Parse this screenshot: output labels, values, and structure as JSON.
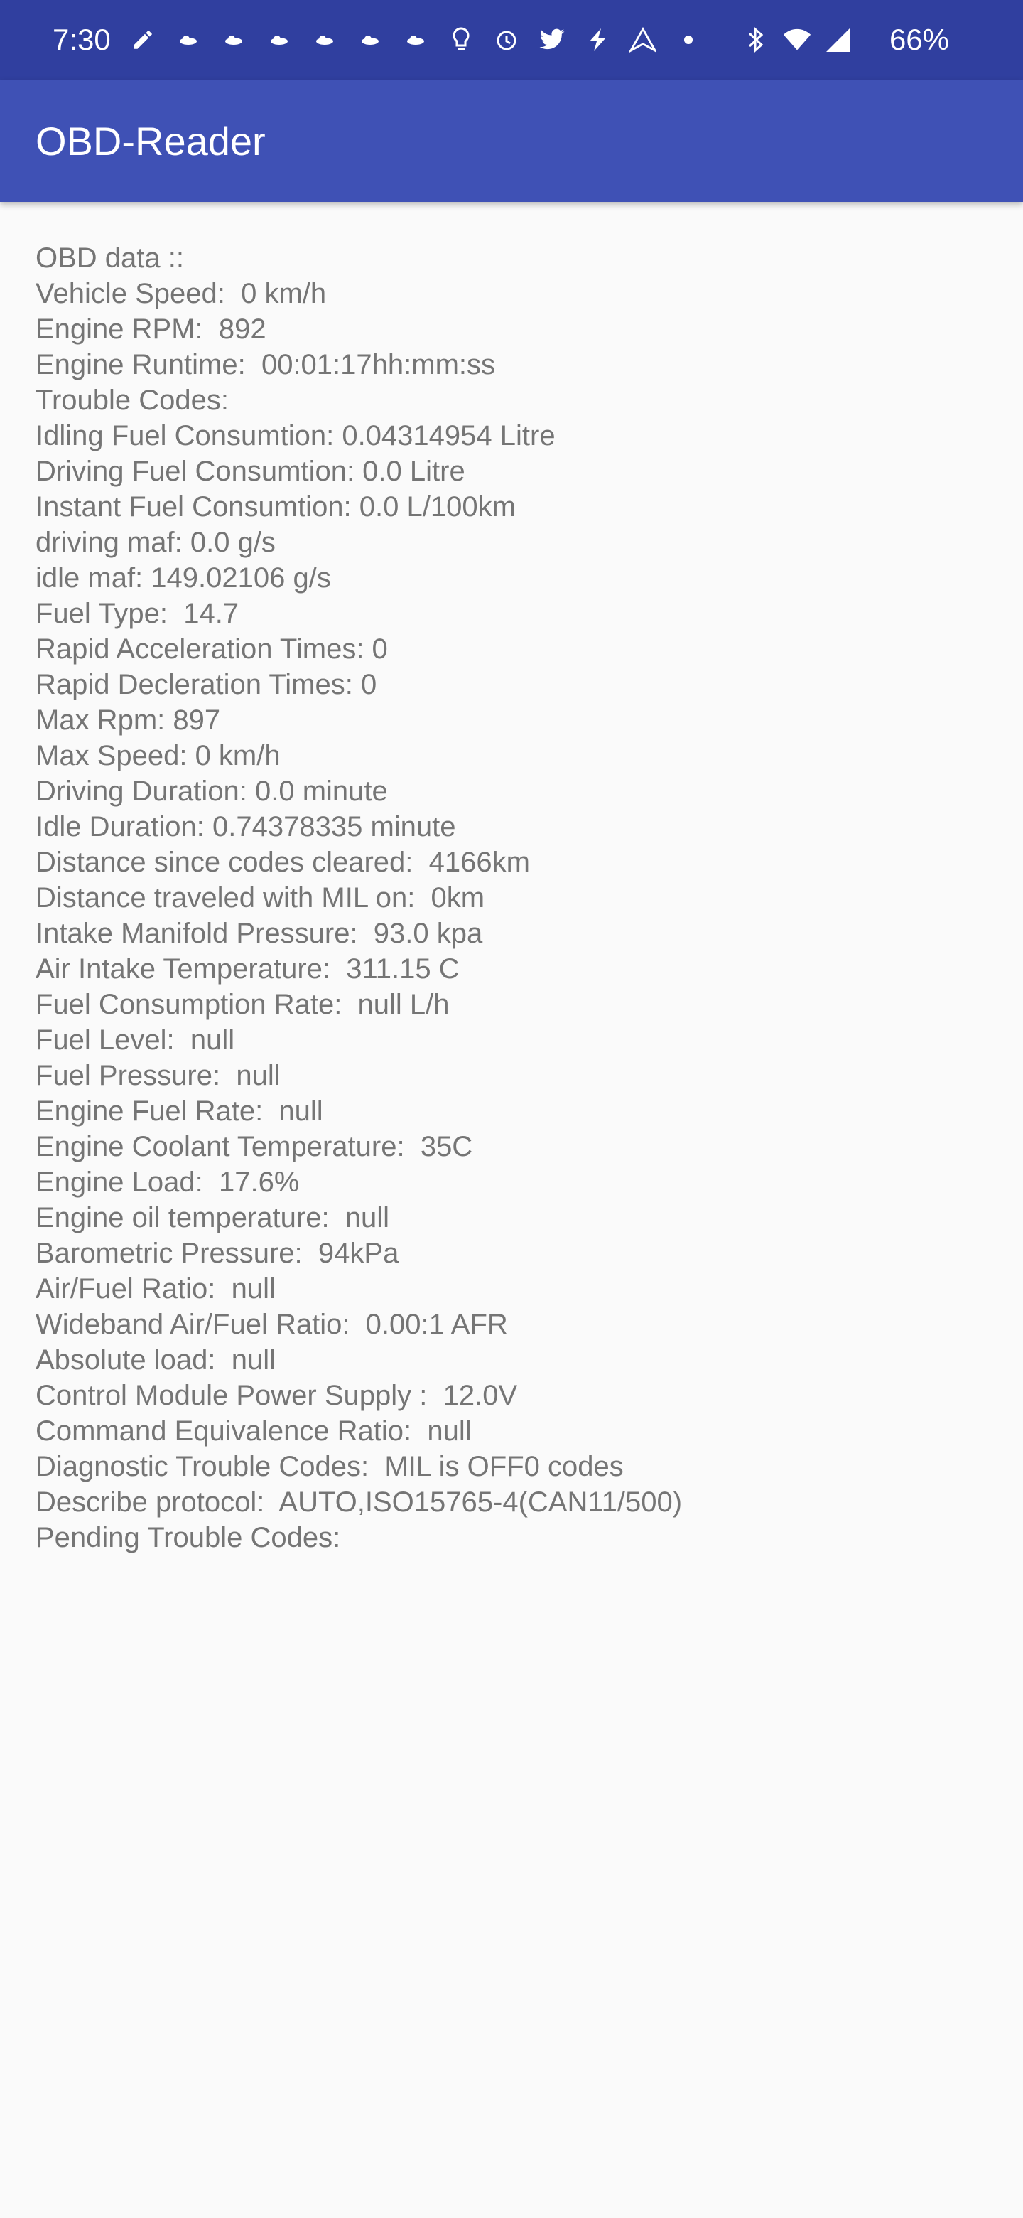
{
  "status_bar": {
    "time": "7:30",
    "battery": "66%",
    "notification_icons": [
      "edit-icon",
      "weather-icon",
      "weather-icon",
      "weather-icon",
      "weather-icon",
      "weather-icon",
      "weather-icon",
      "bulb-icon",
      "alarm-icon",
      "twitter-icon",
      "bolt-icon",
      "navigation-icon",
      "dot-icon"
    ],
    "system_icons": [
      "bluetooth-icon",
      "wifi-icon",
      "cell-signal-icon"
    ]
  },
  "app_bar": {
    "title": "OBD-Reader"
  },
  "obd_data": {
    "lines": [
      "OBD data ::",
      "Vehicle Speed:  0 km/h",
      "Engine RPM:  892",
      "Engine Runtime:  00:01:17hh:mm:ss",
      "Trouble Codes:",
      "Idling Fuel Consumtion: 0.04314954 Litre",
      "Driving Fuel Consumtion: 0.0 Litre",
      "Instant Fuel Consumtion: 0.0 L/100km",
      "driving maf: 0.0 g/s",
      "idle maf: 149.02106 g/s",
      "Fuel Type:  14.7",
      "Rapid Acceleration Times: 0",
      "Rapid Decleration Times: 0",
      "Max Rpm: 897",
      "Max Speed: 0 km/h",
      "Driving Duration: 0.0 minute",
      "Idle Duration: 0.74378335 minute",
      "Distance since codes cleared:  4166km",
      "Distance traveled with MIL on:  0km",
      "Intake Manifold Pressure:  93.0 kpa",
      "Air Intake Temperature:  311.15 C",
      "Fuel Consumption Rate:  null L/h",
      "Fuel Level:  null",
      "Fuel Pressure:  null",
      "Engine Fuel Rate:  null",
      "Engine Coolant Temperature:  35C",
      "Engine Load:  17.6%",
      "Engine oil temperature:  null",
      "Barometric Pressure:  94kPa",
      "Air/Fuel Ratio:  null",
      "Wideband Air/Fuel Ratio:  0.00:1 AFR",
      "Absolute load:  null",
      "Control Module Power Supply :  12.0V",
      "Command Equivalence Ratio:  null",
      "Diagnostic Trouble Codes:  MIL is OFF0 codes",
      "Describe protocol:  AUTO,ISO15765-4(CAN11/500)",
      "Pending Trouble Codes:"
    ]
  },
  "colors": {
    "status_bar": "#303f9f",
    "app_bar": "#3f51b5",
    "text": "#757575",
    "background": "#fafafa"
  }
}
